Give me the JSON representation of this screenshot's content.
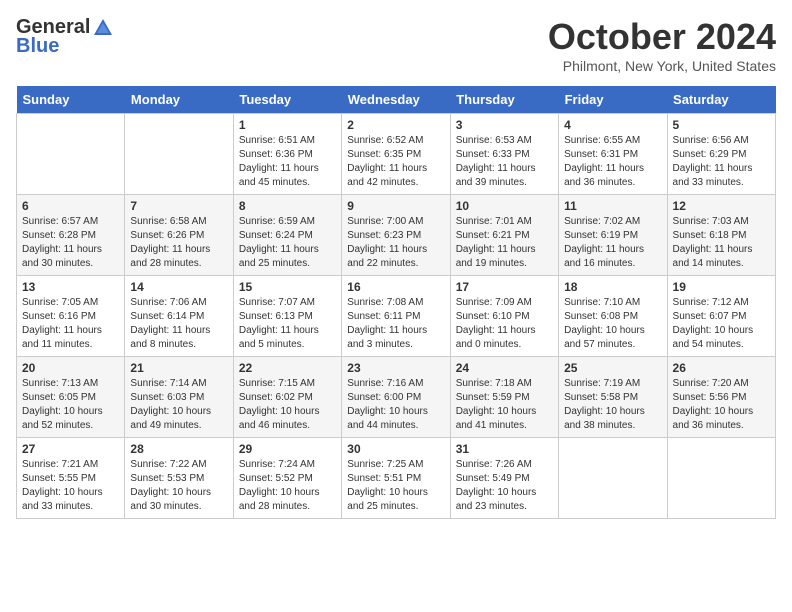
{
  "header": {
    "logo_general": "General",
    "logo_blue": "Blue",
    "month_title": "October 2024",
    "location": "Philmont, New York, United States"
  },
  "days_of_week": [
    "Sunday",
    "Monday",
    "Tuesday",
    "Wednesday",
    "Thursday",
    "Friday",
    "Saturday"
  ],
  "weeks": [
    [
      {
        "day": "",
        "info": ""
      },
      {
        "day": "",
        "info": ""
      },
      {
        "day": "1",
        "info": "Sunrise: 6:51 AM\nSunset: 6:36 PM\nDaylight: 11 hours and 45 minutes."
      },
      {
        "day": "2",
        "info": "Sunrise: 6:52 AM\nSunset: 6:35 PM\nDaylight: 11 hours and 42 minutes."
      },
      {
        "day": "3",
        "info": "Sunrise: 6:53 AM\nSunset: 6:33 PM\nDaylight: 11 hours and 39 minutes."
      },
      {
        "day": "4",
        "info": "Sunrise: 6:55 AM\nSunset: 6:31 PM\nDaylight: 11 hours and 36 minutes."
      },
      {
        "day": "5",
        "info": "Sunrise: 6:56 AM\nSunset: 6:29 PM\nDaylight: 11 hours and 33 minutes."
      }
    ],
    [
      {
        "day": "6",
        "info": "Sunrise: 6:57 AM\nSunset: 6:28 PM\nDaylight: 11 hours and 30 minutes."
      },
      {
        "day": "7",
        "info": "Sunrise: 6:58 AM\nSunset: 6:26 PM\nDaylight: 11 hours and 28 minutes."
      },
      {
        "day": "8",
        "info": "Sunrise: 6:59 AM\nSunset: 6:24 PM\nDaylight: 11 hours and 25 minutes."
      },
      {
        "day": "9",
        "info": "Sunrise: 7:00 AM\nSunset: 6:23 PM\nDaylight: 11 hours and 22 minutes."
      },
      {
        "day": "10",
        "info": "Sunrise: 7:01 AM\nSunset: 6:21 PM\nDaylight: 11 hours and 19 minutes."
      },
      {
        "day": "11",
        "info": "Sunrise: 7:02 AM\nSunset: 6:19 PM\nDaylight: 11 hours and 16 minutes."
      },
      {
        "day": "12",
        "info": "Sunrise: 7:03 AM\nSunset: 6:18 PM\nDaylight: 11 hours and 14 minutes."
      }
    ],
    [
      {
        "day": "13",
        "info": "Sunrise: 7:05 AM\nSunset: 6:16 PM\nDaylight: 11 hours and 11 minutes."
      },
      {
        "day": "14",
        "info": "Sunrise: 7:06 AM\nSunset: 6:14 PM\nDaylight: 11 hours and 8 minutes."
      },
      {
        "day": "15",
        "info": "Sunrise: 7:07 AM\nSunset: 6:13 PM\nDaylight: 11 hours and 5 minutes."
      },
      {
        "day": "16",
        "info": "Sunrise: 7:08 AM\nSunset: 6:11 PM\nDaylight: 11 hours and 3 minutes."
      },
      {
        "day": "17",
        "info": "Sunrise: 7:09 AM\nSunset: 6:10 PM\nDaylight: 11 hours and 0 minutes."
      },
      {
        "day": "18",
        "info": "Sunrise: 7:10 AM\nSunset: 6:08 PM\nDaylight: 10 hours and 57 minutes."
      },
      {
        "day": "19",
        "info": "Sunrise: 7:12 AM\nSunset: 6:07 PM\nDaylight: 10 hours and 54 minutes."
      }
    ],
    [
      {
        "day": "20",
        "info": "Sunrise: 7:13 AM\nSunset: 6:05 PM\nDaylight: 10 hours and 52 minutes."
      },
      {
        "day": "21",
        "info": "Sunrise: 7:14 AM\nSunset: 6:03 PM\nDaylight: 10 hours and 49 minutes."
      },
      {
        "day": "22",
        "info": "Sunrise: 7:15 AM\nSunset: 6:02 PM\nDaylight: 10 hours and 46 minutes."
      },
      {
        "day": "23",
        "info": "Sunrise: 7:16 AM\nSunset: 6:00 PM\nDaylight: 10 hours and 44 minutes."
      },
      {
        "day": "24",
        "info": "Sunrise: 7:18 AM\nSunset: 5:59 PM\nDaylight: 10 hours and 41 minutes."
      },
      {
        "day": "25",
        "info": "Sunrise: 7:19 AM\nSunset: 5:58 PM\nDaylight: 10 hours and 38 minutes."
      },
      {
        "day": "26",
        "info": "Sunrise: 7:20 AM\nSunset: 5:56 PM\nDaylight: 10 hours and 36 minutes."
      }
    ],
    [
      {
        "day": "27",
        "info": "Sunrise: 7:21 AM\nSunset: 5:55 PM\nDaylight: 10 hours and 33 minutes."
      },
      {
        "day": "28",
        "info": "Sunrise: 7:22 AM\nSunset: 5:53 PM\nDaylight: 10 hours and 30 minutes."
      },
      {
        "day": "29",
        "info": "Sunrise: 7:24 AM\nSunset: 5:52 PM\nDaylight: 10 hours and 28 minutes."
      },
      {
        "day": "30",
        "info": "Sunrise: 7:25 AM\nSunset: 5:51 PM\nDaylight: 10 hours and 25 minutes."
      },
      {
        "day": "31",
        "info": "Sunrise: 7:26 AM\nSunset: 5:49 PM\nDaylight: 10 hours and 23 minutes."
      },
      {
        "day": "",
        "info": ""
      },
      {
        "day": "",
        "info": ""
      }
    ]
  ]
}
